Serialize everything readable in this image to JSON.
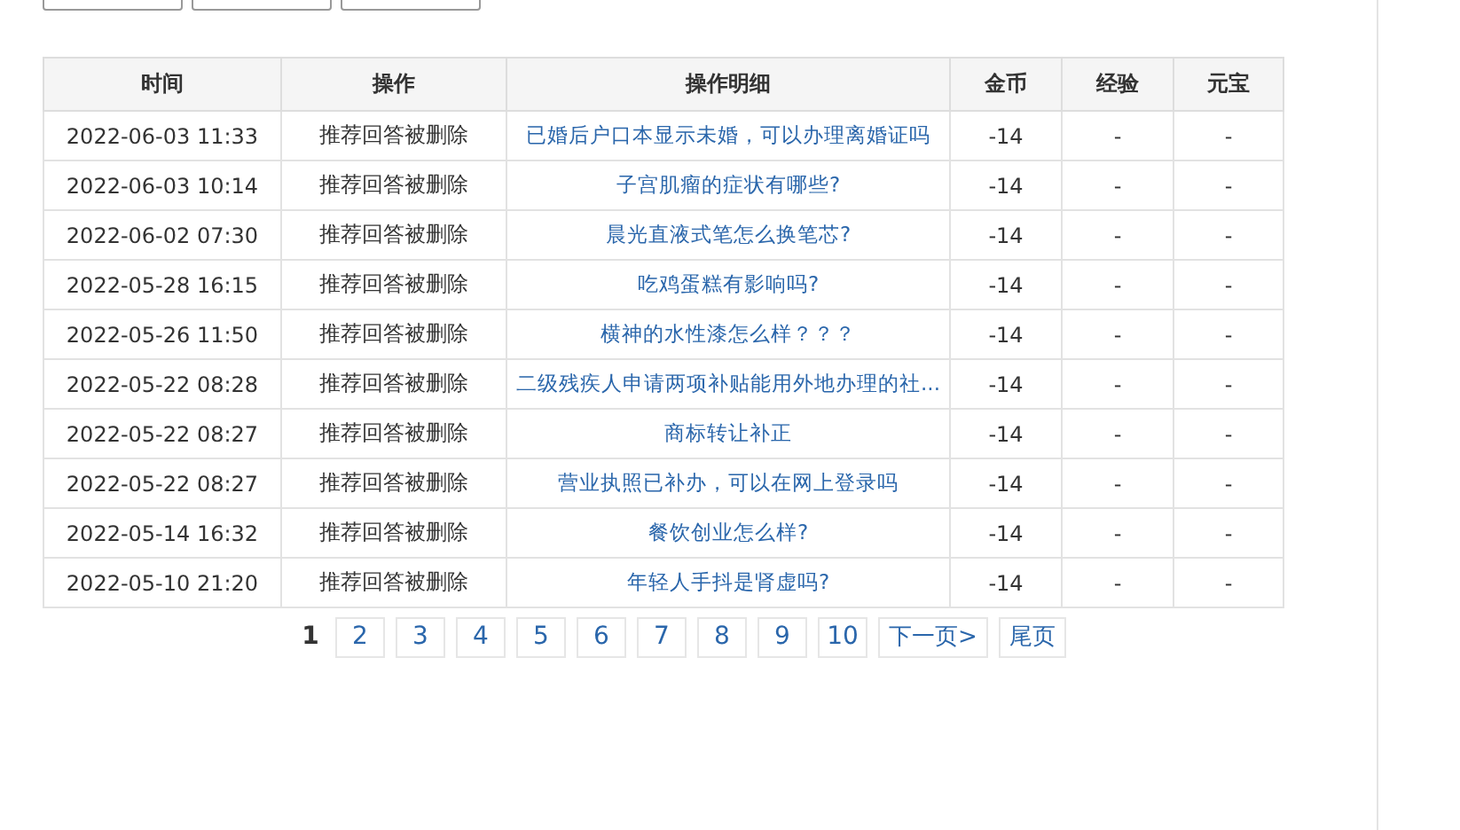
{
  "table": {
    "columns": [
      "时间",
      "操作",
      "操作明细",
      "金币",
      "经验",
      "元宝"
    ],
    "rows": [
      {
        "time": "2022-06-03 11:33",
        "action": "推荐回答被删除",
        "detail": "已婚后户口本显示未婚，可以办理离婚证吗",
        "coins": "-14",
        "exp": "-",
        "ingots": "-"
      },
      {
        "time": "2022-06-03 10:14",
        "action": "推荐回答被删除",
        "detail": "子宫肌瘤的症状有哪些?",
        "coins": "-14",
        "exp": "-",
        "ingots": "-"
      },
      {
        "time": "2022-06-02 07:30",
        "action": "推荐回答被删除",
        "detail": "晨光直液式笔怎么换笔芯?",
        "coins": "-14",
        "exp": "-",
        "ingots": "-"
      },
      {
        "time": "2022-05-28 16:15",
        "action": "推荐回答被删除",
        "detail": "吃鸡蛋糕有影响吗?",
        "coins": "-14",
        "exp": "-",
        "ingots": "-"
      },
      {
        "time": "2022-05-26 11:50",
        "action": "推荐回答被删除",
        "detail": "横神的水性漆怎么样？？？",
        "coins": "-14",
        "exp": "-",
        "ingots": "-"
      },
      {
        "time": "2022-05-22 08:28",
        "action": "推荐回答被删除",
        "detail": "二级残疾人申请两项补贴能用外地办理的社...",
        "coins": "-14",
        "exp": "-",
        "ingots": "-"
      },
      {
        "time": "2022-05-22 08:27",
        "action": "推荐回答被删除",
        "detail": "商标转让补正",
        "coins": "-14",
        "exp": "-",
        "ingots": "-"
      },
      {
        "time": "2022-05-22 08:27",
        "action": "推荐回答被删除",
        "detail": "营业执照已补办，可以在网上登录吗",
        "coins": "-14",
        "exp": "-",
        "ingots": "-"
      },
      {
        "time": "2022-05-14 16:32",
        "action": "推荐回答被删除",
        "detail": "餐饮创业怎么样?",
        "coins": "-14",
        "exp": "-",
        "ingots": "-"
      },
      {
        "time": "2022-05-10 21:20",
        "action": "推荐回答被删除",
        "detail": "年轻人手抖是肾虚吗?",
        "coins": "-14",
        "exp": "-",
        "ingots": "-"
      }
    ]
  },
  "pagination": {
    "pages": [
      {
        "label": "1",
        "selected": true
      },
      {
        "label": "2",
        "selected": false
      },
      {
        "label": "3",
        "selected": false
      },
      {
        "label": "4",
        "selected": false
      },
      {
        "label": "5",
        "selected": false
      },
      {
        "label": "6",
        "selected": false
      },
      {
        "label": "7",
        "selected": false
      },
      {
        "label": "8",
        "selected": false
      },
      {
        "label": "9",
        "selected": false
      },
      {
        "label": "10",
        "selected": false
      }
    ],
    "next": "下一页>",
    "last": "尾页"
  }
}
